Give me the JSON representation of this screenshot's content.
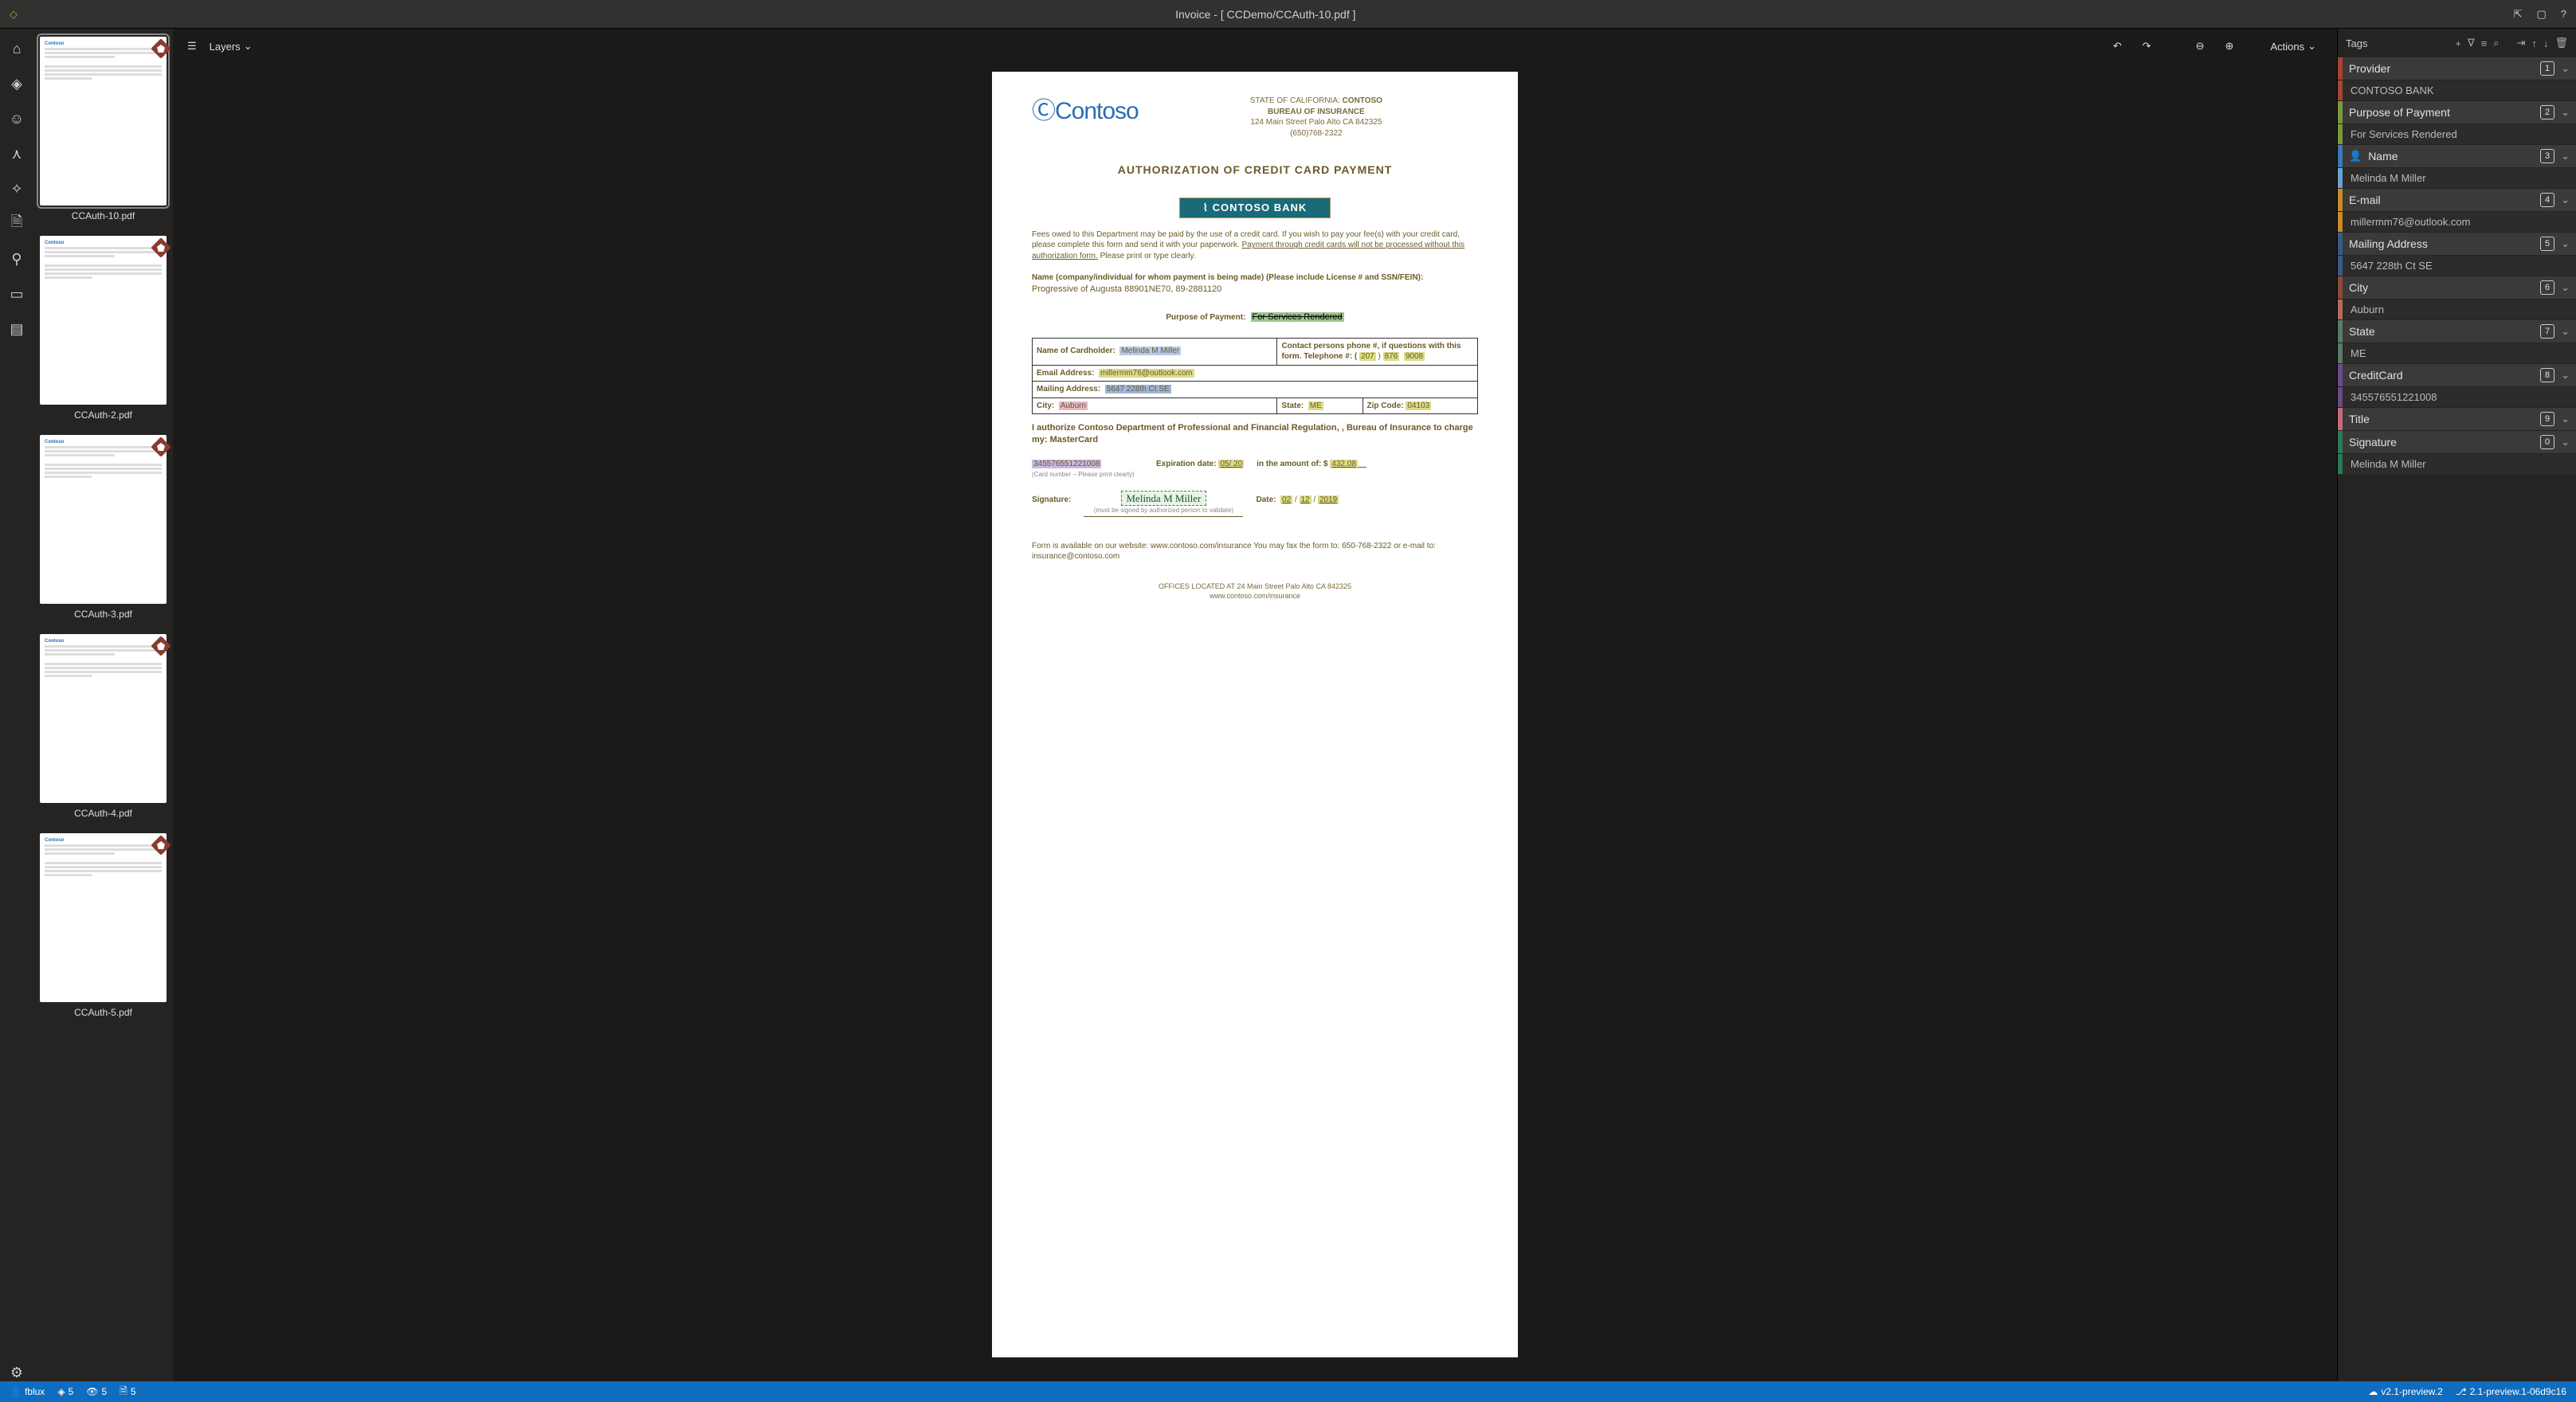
{
  "window": {
    "title": "Invoice - [ CCDemo/CCAuth-10.pdf ]"
  },
  "toolbar": {
    "layers": "Layers",
    "actions": "Actions"
  },
  "thumbs": [
    {
      "name": "CCAuth-10.pdf",
      "active": true
    },
    {
      "name": "CCAuth-2.pdf",
      "active": false
    },
    {
      "name": "CCAuth-3.pdf",
      "active": false
    },
    {
      "name": "CCAuth-4.pdf",
      "active": false
    },
    {
      "name": "CCAuth-5.pdf",
      "active": false
    }
  ],
  "document": {
    "logo": "Contoso",
    "hd_state": "STATE OF CALIFORNIA:",
    "hd_co": "CONTOSO",
    "hd_bureau": "BUREAU OF INSURANCE",
    "hd_addr": "124 Main Street Palo Alto CA 842325",
    "hd_phone": "(650)768-2322",
    "title": "AUTHORIZATION OF CREDIT CARD PAYMENT",
    "bank": "CONTOSO BANK",
    "fees1": "Fees owed to this Department may be paid by the use of a credit card.  If you wish to pay your fee(s) with your credit card, please complete this form and send it with your paperwork.  ",
    "fees_u": "Payment through credit cards will not be processed without this authorization form.",
    "fees2": "  Please print or type clearly.",
    "name_lbl": "Name (company/individual for whom payment is being made) (Please include License # and SSN/FEIN):",
    "name_val": "Progressive of Augusta  88901NE70,  89-2881120",
    "purpose_lbl": "Purpose of Payment:",
    "purpose_val": "For Services Rendered",
    "table": {
      "cardholder_lbl": "Name of Cardholder:",
      "cardholder_val": "Melinda M Miller",
      "contact_lbl": "Contact persons phone #, if questions with this form. Telephone #: ( ",
      "contact_a": "207",
      "contact_b": "876",
      "contact_c": "9008",
      "email_lbl": "Email Address:",
      "email_val": "millermm76@outlook.com",
      "mail_lbl": "Mailing Address:",
      "mail_val": "5647 228th Ct SE",
      "city_lbl": "City:",
      "city_val": "Auburn",
      "state_lbl": "State:",
      "state_val": "ME",
      "zip_lbl": "Zip Code:",
      "zip_val": "04103"
    },
    "auth": "I authorize Contoso Department of Professional and Financial Regulation, , Bureau of Insurance to charge my:   MasterCard",
    "card_num": "345576551221008",
    "card_note": "(Card number – Please print clearly)",
    "exp_lbl": "Expiration date:",
    "exp_val": "05/ 20",
    "amt_lbl": "in the amount of: $",
    "amt_val": "432.08",
    "sig_lbl": "Signature:",
    "sig_val": "Melinda M Miller",
    "sig_note": "(must be signed by authorized person to validate)",
    "date_lbl": "Date:",
    "date_m": "02",
    "date_d": "12",
    "date_y": "2019",
    "foot1": "Form is available on our website:  www.contoso.com/insurance You may fax the form to: 650-768-2322 or e-mail to:  insurance@contoso.com",
    "foot2": "OFFICES LOCATED AT 24 Main Street Palo Alto CA 842325",
    "foot3": "www.contoso.com/insurance"
  },
  "tagsPanel": {
    "title": "Tags"
  },
  "tags": [
    {
      "name": "Provider",
      "num": "1",
      "val": "CONTOSO BANK",
      "c": "#a84434",
      "vc": "#a84434"
    },
    {
      "name": "Purpose of Payment",
      "num": "2",
      "val": "For Services Rendered",
      "c": "#7a9a3a",
      "vc": "#7a9a3a"
    },
    {
      "name": "Name",
      "num": "3",
      "val": "Melinda M Miller",
      "c": "#3a78b8",
      "vc": "#6aa0d8",
      "icon": "user"
    },
    {
      "name": "E-mail",
      "num": "4",
      "val": "millermm76@outlook.com",
      "c": "#c88a2a",
      "vc": "#c88a2a"
    },
    {
      "name": "Mailing Address",
      "num": "5",
      "val": "5647 228th Ct SE",
      "c": "#3a5a88",
      "vc": "#3a5a88"
    },
    {
      "name": "City",
      "num": "6",
      "val": "Auburn",
      "c": "#8a4a3a",
      "vc": "#b86a5a"
    },
    {
      "name": "State",
      "num": "7",
      "val": "ME",
      "c": "#5a7a6a",
      "vc": "#5a7a6a"
    },
    {
      "name": "CreditCard",
      "num": "8",
      "val": "345576551221008",
      "c": "#6a4a8a",
      "vc": "#6a4a8a"
    },
    {
      "name": "Title",
      "num": "9",
      "val": null,
      "c": "#c86a7a",
      "vc": "#c86a7a"
    },
    {
      "name": "Signature",
      "num": "0",
      "val": "Melinda M Miller",
      "c": "#2a7a5a",
      "vc": "#2a7a5a"
    }
  ],
  "status": {
    "user": "fblux",
    "tagcount": "5",
    "viewcount": "5",
    "doccount": "5",
    "ver1": "v2.1-preview.2",
    "ver2": "2.1-preview.1-06d9c16"
  }
}
